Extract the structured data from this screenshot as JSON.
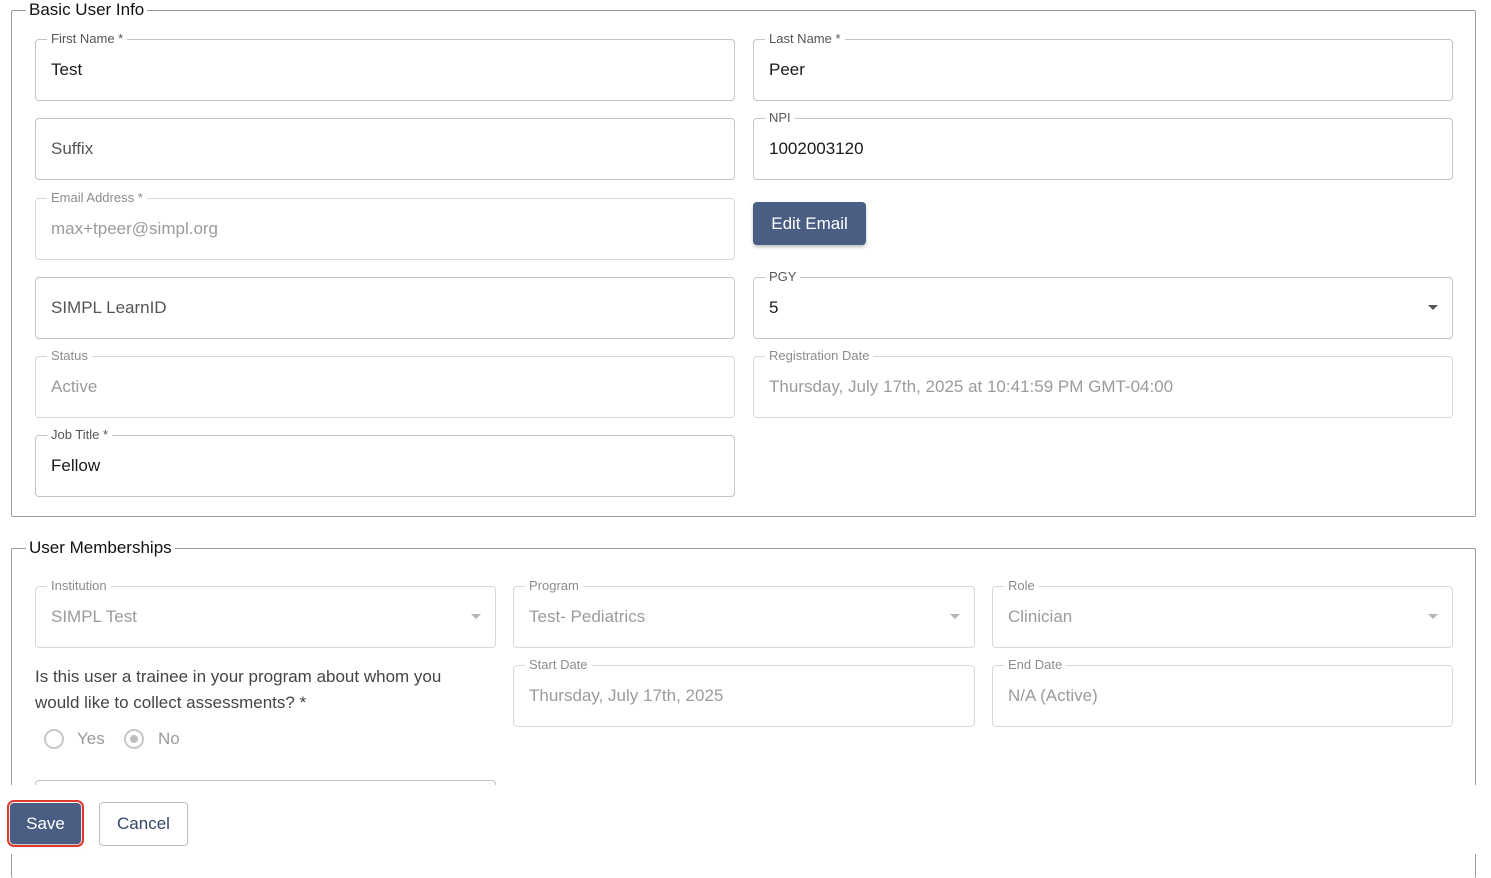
{
  "basic_info": {
    "legend": "Basic User Info",
    "first_name": {
      "label": "First Name *",
      "value": "Test"
    },
    "last_name": {
      "label": "Last Name *",
      "value": "Peer"
    },
    "suffix": {
      "placeholder": "Suffix"
    },
    "npi": {
      "label": "NPI",
      "value": "1002003120"
    },
    "email": {
      "label": "Email Address *",
      "value": "max+tpeer@simpl.org"
    },
    "edit_email_label": "Edit Email",
    "learn_id": {
      "placeholder": "SIMPL LearnID"
    },
    "pgy": {
      "label": "PGY",
      "value": "5"
    },
    "status": {
      "label": "Status",
      "value": "Active"
    },
    "registration_date": {
      "label": "Registration Date",
      "value": "Thursday, July 17th, 2025 at 10:41:59 PM GMT-04:00"
    },
    "job_title": {
      "label": "Job Title *",
      "value": "Fellow"
    }
  },
  "memberships": {
    "legend": "User Memberships",
    "institution": {
      "label": "Institution",
      "value": "SIMPL Test"
    },
    "program": {
      "label": "Program",
      "value": "Test- Pediatrics"
    },
    "role": {
      "label": "Role",
      "value": "Clinician"
    },
    "trainee_question": "Is this user a trainee in your program about whom you would like to collect assessments? *",
    "trainee_options": {
      "yes": "Yes",
      "no": "No",
      "selected": "No"
    },
    "start_date": {
      "label": "Start Date",
      "value": "Thursday, July 17th, 2025"
    },
    "end_date": {
      "label": "End Date",
      "value": "N/A (Active)"
    }
  },
  "footer": {
    "save_label": "Save",
    "cancel_label": "Cancel"
  }
}
